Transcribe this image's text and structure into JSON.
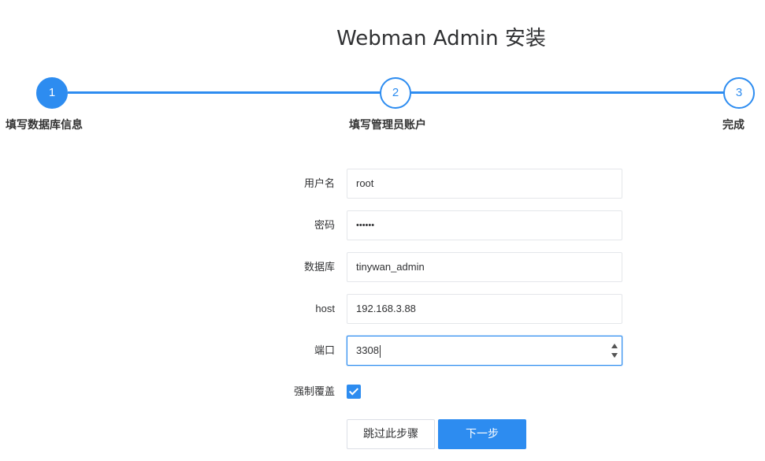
{
  "title": "Webman Admin 安装",
  "steps": [
    {
      "number": "1",
      "label": "填写数据库信息"
    },
    {
      "number": "2",
      "label": "填写管理员账户"
    },
    {
      "number": "3",
      "label": "完成"
    }
  ],
  "form": {
    "username": {
      "label": "用户名",
      "value": "root"
    },
    "password": {
      "label": "密码",
      "value": "••••••"
    },
    "database": {
      "label": "数据库",
      "value": "tinywan_admin"
    },
    "host": {
      "label": "host",
      "value": "192.168.3.88"
    },
    "port": {
      "label": "端口",
      "value": "3308"
    },
    "force_overwrite": {
      "label": "强制覆盖",
      "checked": true
    }
  },
  "buttons": {
    "skip": "跳过此步骤",
    "next": "下一步"
  },
  "colors": {
    "accent": "#2d8cf0"
  }
}
